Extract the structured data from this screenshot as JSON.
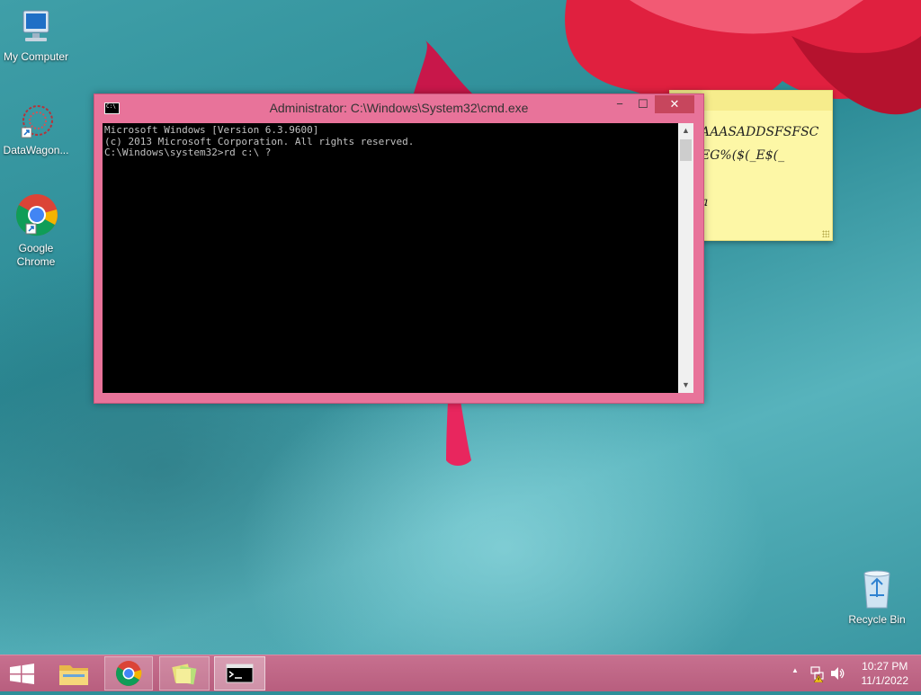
{
  "desktop": {
    "icons": [
      {
        "label": "My Computer",
        "icon": "computer-icon"
      },
      {
        "label": "DataWagon...",
        "icon": "datawagon-icon"
      },
      {
        "label": "Google Chrome",
        "line1": "Google",
        "line2": "Chrome",
        "icon": "chrome-icon"
      },
      {
        "label": "Recycle Bin",
        "icon": "recycle-bin-icon"
      }
    ]
  },
  "sticky_note": {
    "lines": [
      "AAASADDSFSFSC",
      "EG%($(_E$(_",
      "a"
    ]
  },
  "cmd_window": {
    "title": "Administrator: C:\\Windows\\System32\\cmd.exe",
    "console_lines": [
      "Microsoft Windows [Version 6.3.9600]",
      "(c) 2013 Microsoft Corporation. All rights reserved.",
      "C:\\Windows\\system32>rd c:\\ ?"
    ],
    "buttons": {
      "minimize": "−",
      "maximize": "☐",
      "close": "✕"
    }
  },
  "taskbar": {
    "apps": [
      "start-icon",
      "file-explorer-icon",
      "chrome-icon",
      "sticky-notes-icon",
      "cmd-icon"
    ],
    "tray": {
      "chevron": "▲"
    },
    "clock": {
      "time": "10:27 PM",
      "date": "11/1/2022"
    }
  },
  "colors": {
    "accent": "#e8739a",
    "taskbar": "#c0678a",
    "close_button": "#c7465d",
    "sticky": "#fdf7a6",
    "desktop": "#2e8f99"
  }
}
